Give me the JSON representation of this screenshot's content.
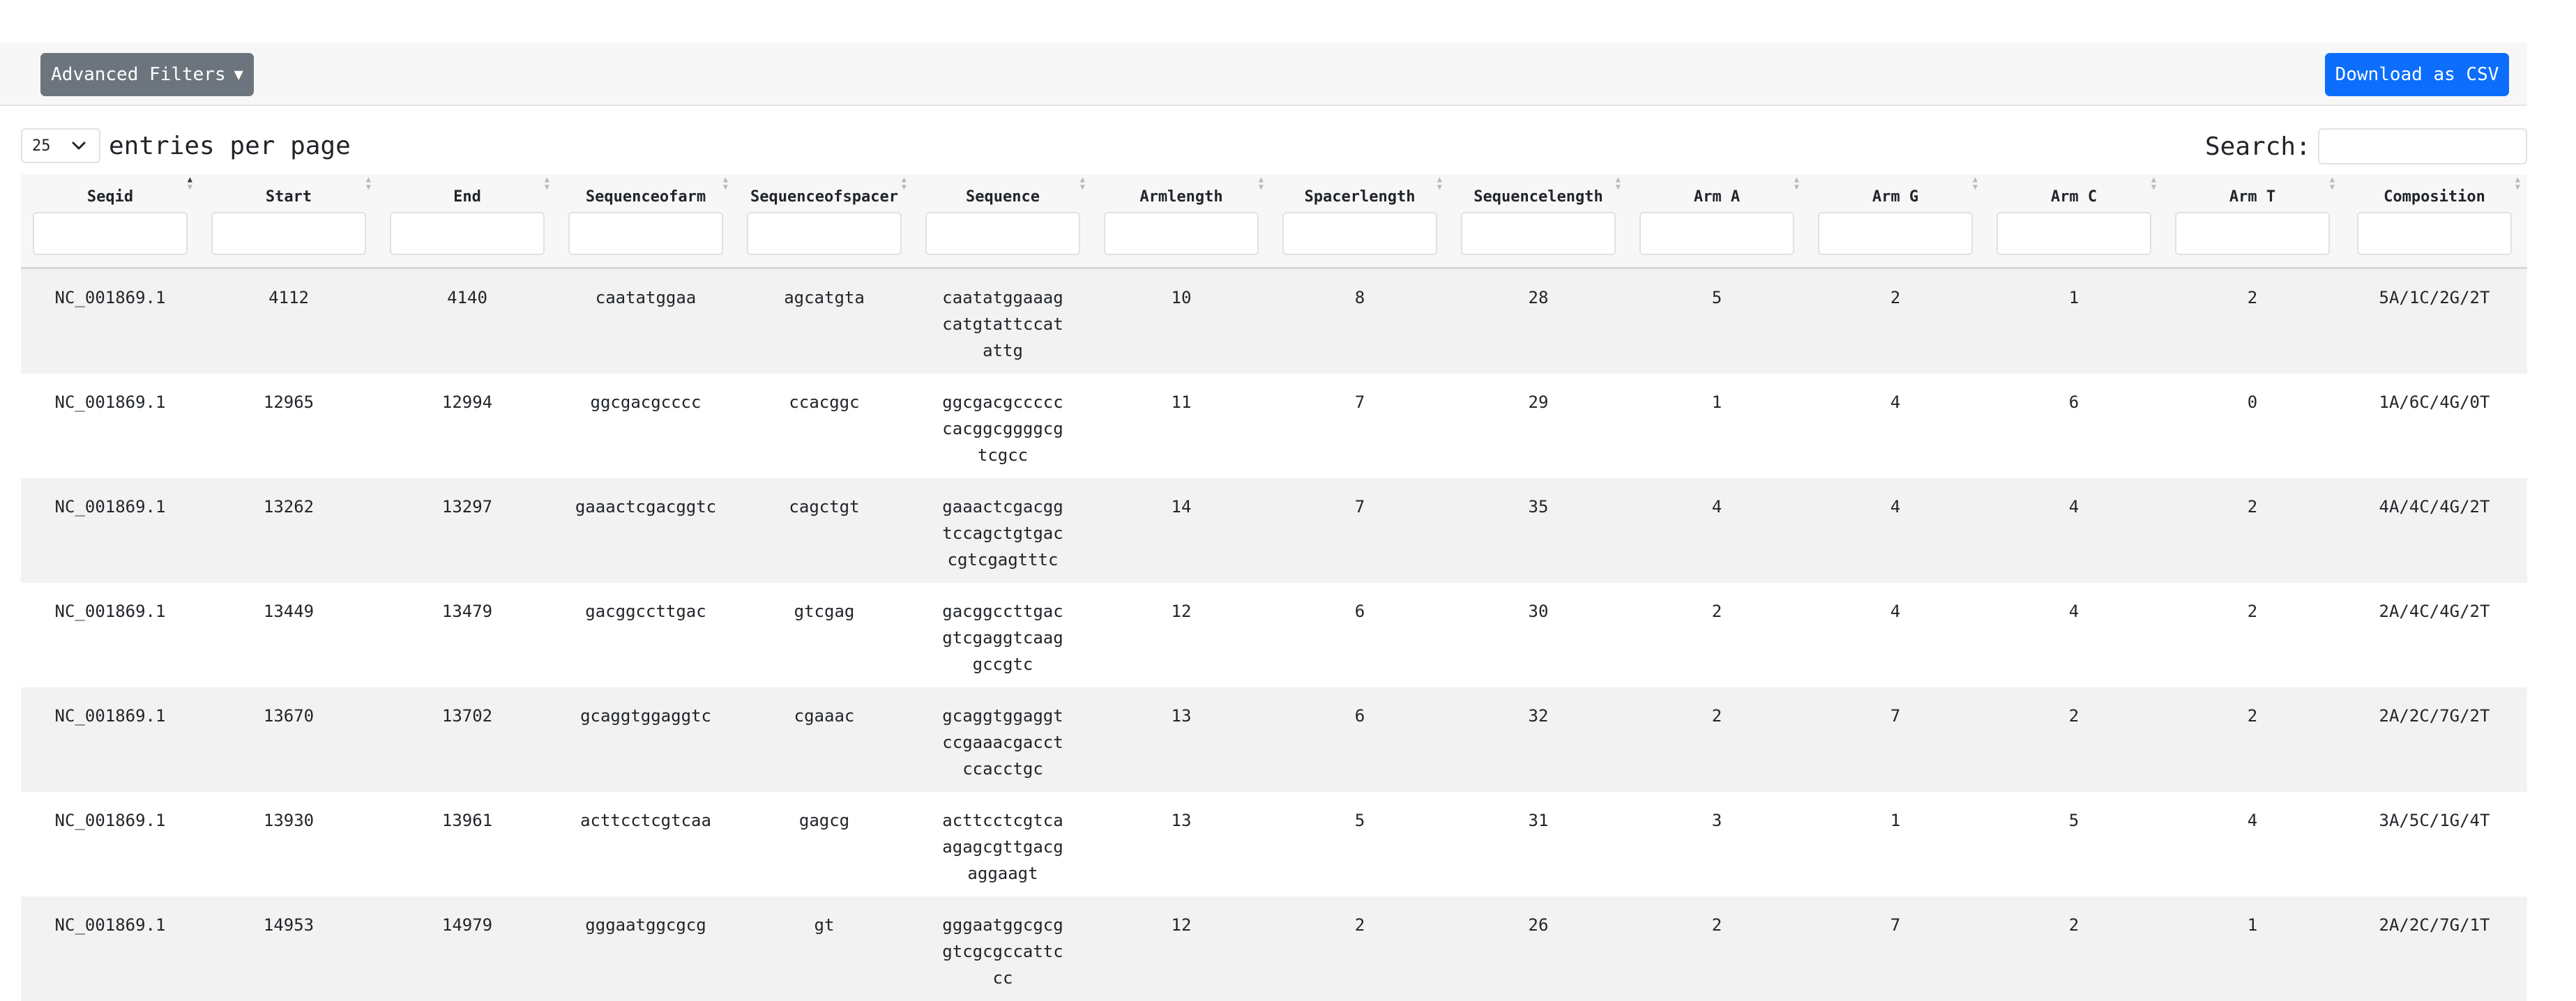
{
  "toolbar": {
    "advanced_filters_label": "Advanced Filters",
    "advanced_filters_caret": "▼",
    "download_label": "Download as CSV"
  },
  "length_menu": {
    "value": "25",
    "label": "entries per page"
  },
  "search": {
    "label": "Search:",
    "value": ""
  },
  "colors": {
    "secondary_button": "#6c757d",
    "primary_button": "#0d6efd",
    "striped_row": "#f2f2f2"
  },
  "table": {
    "columns": [
      "Seqid",
      "Start",
      "End",
      "Sequenceofarm",
      "Sequenceofspacer",
      "Sequence",
      "Armlength",
      "Spacerlength",
      "Sequencelength",
      "Arm A",
      "Arm G",
      "Arm C",
      "Arm T",
      "Composition"
    ],
    "rows": [
      [
        "NC_001869.1",
        "4112",
        "4140",
        "caatatggaa",
        "agcatgta",
        "caatatggaaagcatgtattccatattg",
        "10",
        "8",
        "28",
        "5",
        "2",
        "1",
        "2",
        "5A/1C/2G/2T"
      ],
      [
        "NC_001869.1",
        "12965",
        "12994",
        "ggcgacgcccc",
        "ccacggc",
        "ggcgacgccccccacggcggggcgtcgcc",
        "11",
        "7",
        "29",
        "1",
        "4",
        "6",
        "0",
        "1A/6C/4G/0T"
      ],
      [
        "NC_001869.1",
        "13262",
        "13297",
        "gaaactcgacggtc",
        "cagctgt",
        "gaaactcgacggtccagctgtgaccgtcgagtttc",
        "14",
        "7",
        "35",
        "4",
        "4",
        "4",
        "2",
        "4A/4C/4G/2T"
      ],
      [
        "NC_001869.1",
        "13449",
        "13479",
        "gacggccttgac",
        "gtcgag",
        "gacggccttgacgtcgaggtcaaggccgtc",
        "12",
        "6",
        "30",
        "2",
        "4",
        "4",
        "2",
        "2A/4C/4G/2T"
      ],
      [
        "NC_001869.1",
        "13670",
        "13702",
        "gcaggtggaggtc",
        "cgaaac",
        "gcaggtggaggtccgaaacgacctccacctgc",
        "13",
        "6",
        "32",
        "2",
        "7",
        "2",
        "2",
        "2A/2C/7G/2T"
      ],
      [
        "NC_001869.1",
        "13930",
        "13961",
        "acttcctcgtcaa",
        "gagcg",
        "acttcctcgtcaagagcgttgacgaggaagt",
        "13",
        "5",
        "31",
        "3",
        "1",
        "5",
        "4",
        "3A/5C/1G/4T"
      ],
      [
        "NC_001869.1",
        "14953",
        "14979",
        "gggaatggcgcg",
        "gt",
        "gggaatggcgcggtcgcgccattccc",
        "12",
        "2",
        "26",
        "2",
        "7",
        "2",
        "1",
        "2A/2C/7G/1T"
      ]
    ]
  }
}
